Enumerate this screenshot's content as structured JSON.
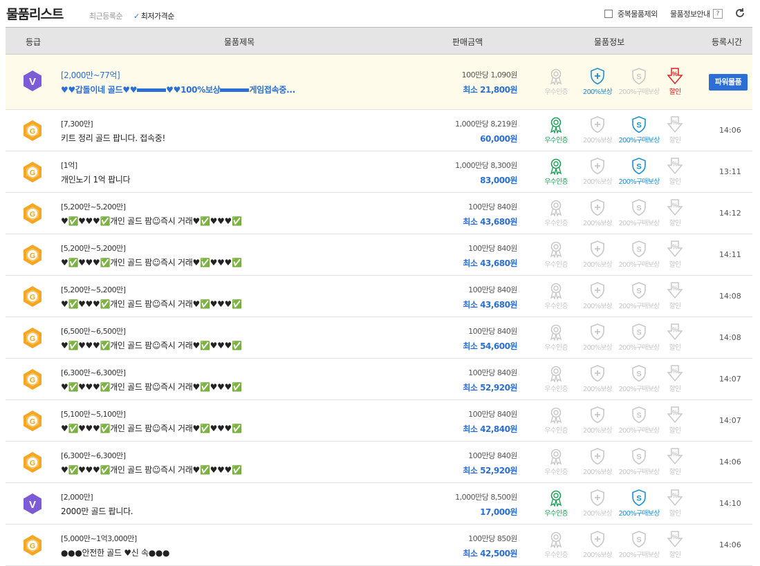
{
  "header": {
    "title": "물품리스트",
    "sort_recent": "최근등록순",
    "sort_lowest": "최저가격순",
    "exclude_dup": "중복물품제외",
    "info_guide": "물품정보안내",
    "info_q": "?"
  },
  "columns": [
    "등급",
    "물품제목",
    "판매금액",
    "물품정보",
    "등록시간"
  ],
  "icon_labels": [
    "우수인증",
    "200%보상",
    "200%구매보상",
    "할인"
  ],
  "power_button": "파워물품",
  "rows": [
    {
      "grade": "V",
      "range": "[2,000만~77억]",
      "name": "♥♥갑돌이네 골드♥♥",
      "name2": "♥♥100%보상",
      "name3": "게임접속중...",
      "unit": "100만당 1,090원",
      "total": "최소 21,800원",
      "icons": [
        false,
        true,
        false,
        true
      ],
      "time": "",
      "power": true
    },
    {
      "grade": "G",
      "range": "[7,300만]",
      "name": "키트 정리 골드 팝니다. 접속중!",
      "unit": "1,000만당 8,219원",
      "total": "60,000원",
      "icons": [
        true,
        false,
        true,
        false
      ],
      "time": "14:06"
    },
    {
      "grade": "G",
      "range": "[1억]",
      "name": "개인노기 1억 팝니다",
      "unit": "1,000만당 8,300원",
      "total": "83,000원",
      "icons": [
        true,
        false,
        true,
        false
      ],
      "time": "13:11"
    },
    {
      "grade": "G",
      "range": "[5,200만~5,200만]",
      "name": "♥✅♥♥♥✅개인 골드 팜☺즉시 거래♥✅♥♥♥✅",
      "unit": "100만당 840원",
      "total": "최소 43,680원",
      "icons": [
        false,
        false,
        false,
        false
      ],
      "time": "14:12"
    },
    {
      "grade": "G",
      "range": "[5,200만~5,200만]",
      "name": "♥✅♥♥♥✅개인 골드 팜☺즉시 거래♥✅♥♥♥✅",
      "unit": "100만당 840원",
      "total": "최소 43,680원",
      "icons": [
        false,
        false,
        false,
        false
      ],
      "time": "14:11"
    },
    {
      "grade": "G",
      "range": "[5,200만~5,200만]",
      "name": "♥✅♥♥♥✅개인 골드 팜☺즉시 거래♥✅♥♥♥✅",
      "unit": "100만당 840원",
      "total": "최소 43,680원",
      "icons": [
        false,
        false,
        false,
        false
      ],
      "time": "14:08"
    },
    {
      "grade": "G",
      "range": "[6,500만~6,500만]",
      "name": "♥✅♥♥♥✅개인 골드 팜☺즉시 거래♥✅♥♥♥✅",
      "unit": "100만당 840원",
      "total": "최소 54,600원",
      "icons": [
        false,
        false,
        false,
        false
      ],
      "time": "14:08"
    },
    {
      "grade": "G",
      "range": "[6,300만~6,300만]",
      "name": "♥✅♥♥♥✅개인 골드 팜☺즉시 거래♥✅♥♥♥✅",
      "unit": "100만당 840원",
      "total": "최소 52,920원",
      "icons": [
        false,
        false,
        false,
        false
      ],
      "time": "14:07"
    },
    {
      "grade": "G",
      "range": "[5,100만~5,100만]",
      "name": "♥✅♥♥♥✅개인 골드 팜☺즉시 거래♥✅♥♥♥✅",
      "unit": "100만당 840원",
      "total": "최소 42,840원",
      "icons": [
        false,
        false,
        false,
        false
      ],
      "time": "14:07"
    },
    {
      "grade": "G",
      "range": "[6,300만~6,300만]",
      "name": "♥✅♥♥♥✅개인 골드 팜☺즉시 거래♥✅♥♥♥✅",
      "unit": "100만당 840원",
      "total": "최소 52,920원",
      "icons": [
        false,
        false,
        false,
        false
      ],
      "time": "14:06"
    },
    {
      "grade": "V",
      "range": "[2,000만]",
      "name": "2000만 골드 팝니다.",
      "unit": "1,000만당 8,500원",
      "total": "17,000원",
      "icons": [
        true,
        false,
        true,
        false
      ],
      "time": "14:10"
    },
    {
      "grade": "G",
      "range": "[5,000만~1억3,000만]",
      "name": "●●●안전한 골드 ♥신 속●●●",
      "unit": "100만당 850원",
      "total": "최소 42,500원",
      "icons": [
        false,
        false,
        false,
        false
      ],
      "time": "14:06"
    }
  ],
  "colors": {
    "accent": "#2b6fd6",
    "header_bg": "#e5e5e5",
    "power_bg": "#fffbea",
    "grade_v": "#7b5cd6",
    "grade_g": "#f5a623"
  }
}
